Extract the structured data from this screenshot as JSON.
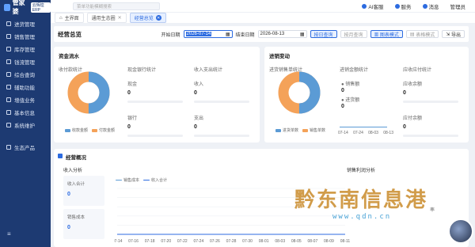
{
  "app": {
    "logo_text": "管家婆",
    "logo_sub": "云辉煌ERP"
  },
  "sidebar": {
    "items": [
      {
        "label": "进货管理"
      },
      {
        "label": "销售管理"
      },
      {
        "label": "库存管理"
      },
      {
        "label": "钱流管理"
      },
      {
        "label": "综合查询"
      },
      {
        "label": "辅助功能"
      },
      {
        "label": "增值业务"
      },
      {
        "label": "基本信息"
      },
      {
        "label": "系统维护"
      },
      {
        "label": "生态产品"
      }
    ]
  },
  "topbar": {
    "search_placeholder": "菜单功能模糊搜索",
    "ai_label": "AI客服",
    "service_label": "服务",
    "message_label": "消息",
    "user_label": "管理员"
  },
  "tabs": [
    {
      "label": "主界面"
    },
    {
      "label": "通用生态圈"
    },
    {
      "label": "经营总览"
    }
  ],
  "toolbar": {
    "title": "经营总览",
    "start_label": "开始日期",
    "start_date": "2026-07-14",
    "end_label": "结束日期",
    "end_date": "2026-08-13",
    "query_btn": "按日查询",
    "month_btn": "按月查询",
    "chart_mode": "图表模式",
    "table_mode": "表格模式",
    "export": "导出"
  },
  "funds": {
    "title": "资金流水",
    "pie_title": "收付款统计",
    "legend": [
      "收款金额",
      "付款金额"
    ],
    "cash_bank_title": "现金银行统计",
    "cash_label": "现金",
    "cash_value": "0",
    "bank_label": "银行",
    "bank_value": "0",
    "inout_title": "收入支出统计",
    "income_label": "收入",
    "income_value": "0",
    "expense_label": "支出",
    "expense_value": "0"
  },
  "sales": {
    "title": "进销变动",
    "pie_title": "进货销售单统计",
    "legend": [
      "进货单数",
      "销售单数"
    ],
    "amount_title": "进销金额统计",
    "amount_legend": [
      "销售额",
      "进货额"
    ],
    "amount_value": "0",
    "dates": [
      "07-14",
      "07-24",
      "08-03",
      "08-13"
    ],
    "ar_title": "应收应付统计",
    "receivable_label": "应收余额",
    "receivable_value": "0",
    "payable_label": "应付余额",
    "payable_value": "0"
  },
  "overview": {
    "title": "经营概况",
    "income_title": "收入分析",
    "income_total_label": "收入合计",
    "income_total_value": "0",
    "sales_cost_label": "销售成本",
    "sales_cost_value": "0",
    "legend": [
      "销售成本",
      "收入合计"
    ],
    "profit_title": "销售利润分析",
    "rate_label": "率"
  },
  "chart_data": {
    "type": "line",
    "x": [
      "07-14",
      "07-16",
      "07-18",
      "07-20",
      "07-22",
      "07-24",
      "07-26",
      "07-28",
      "07-30",
      "08-01",
      "08-03",
      "08-05",
      "08-07",
      "08-09",
      "08-11"
    ],
    "series": [
      {
        "name": "销售成本",
        "values": [
          0,
          0,
          0,
          0,
          0,
          0,
          0,
          0,
          0,
          0,
          0,
          0,
          0,
          0,
          0
        ]
      },
      {
        "name": "收入合计",
        "values": [
          0,
          0,
          0,
          0,
          0,
          0,
          0,
          0,
          0,
          0,
          0,
          0,
          0,
          0,
          0
        ]
      }
    ],
    "colors": [
      "#5b9bd5",
      "#2c6be0"
    ]
  },
  "colors": {
    "accent": "#2c6be0",
    "sidebar": "#1d3a72",
    "pie_blue": "#5b9bd5",
    "pie_orange": "#f4a259"
  },
  "watermark": {
    "text": "黔东南信息港",
    "url": "www.qdn.cn"
  }
}
